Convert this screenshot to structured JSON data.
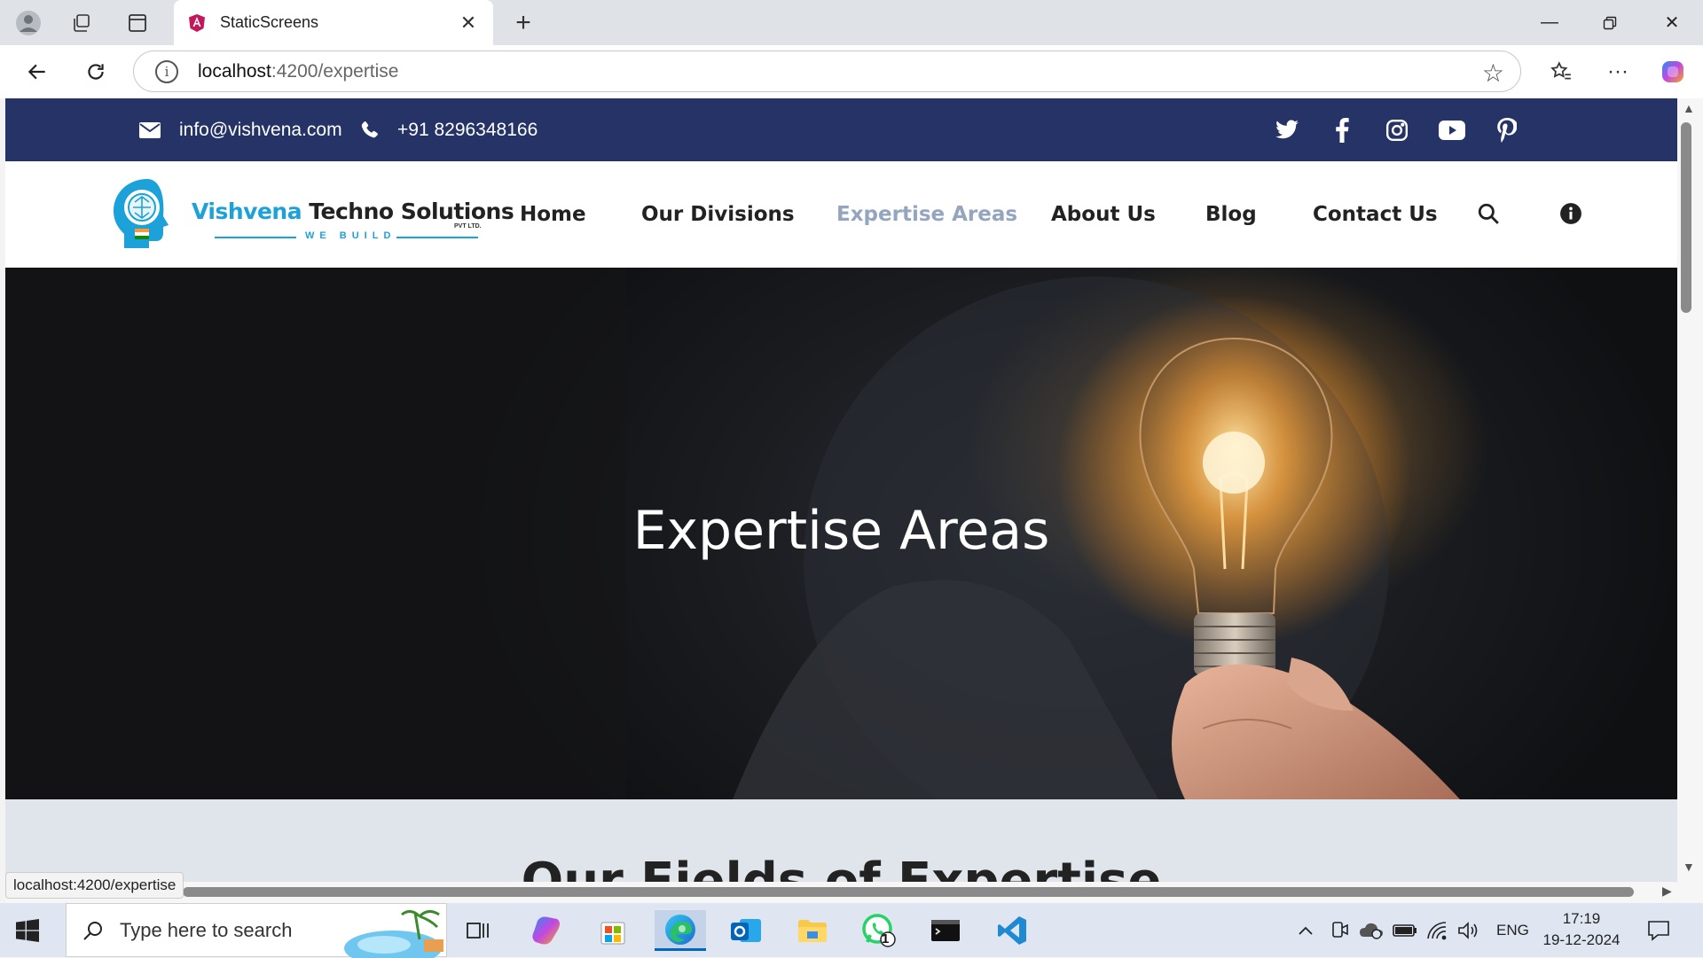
{
  "browser": {
    "tab_title": "StaticScreens",
    "url_host": "localhost",
    "url_path": ":4200/expertise"
  },
  "topbar": {
    "email": "info@vishvena.com",
    "phone": "+91 8296348166",
    "socials": [
      "twitter-icon",
      "facebook-icon",
      "instagram-icon",
      "youtube-icon",
      "pinterest-icon"
    ]
  },
  "logo": {
    "name_primary": "Vishvena",
    "name_secondary": "Techno Solutions",
    "suffix": "PVT LTD.",
    "tagline": "WE BUILD"
  },
  "nav": {
    "items": [
      {
        "label": "Home",
        "active": false
      },
      {
        "label": "Our Divisions",
        "active": false
      },
      {
        "label": "Expertise Areas",
        "active": true
      },
      {
        "label": "About Us",
        "active": false
      },
      {
        "label": "Blog",
        "active": false
      },
      {
        "label": "Contact Us",
        "active": false
      }
    ]
  },
  "hero": {
    "title": "Expertise Areas"
  },
  "section2": {
    "title": "Our Fields of Expertise"
  },
  "status_tooltip": "localhost:4200/expertise",
  "taskbar": {
    "search_placeholder": "Type here to search",
    "language": "ENG",
    "time": "17:19",
    "date": "19-12-2024",
    "whatsapp_badge": "1"
  },
  "colors": {
    "topbar_bg": "#263366",
    "brand_blue": "#1da1d9",
    "active_nav": "#93a5bf",
    "section_bg": "#dfe5ea"
  }
}
